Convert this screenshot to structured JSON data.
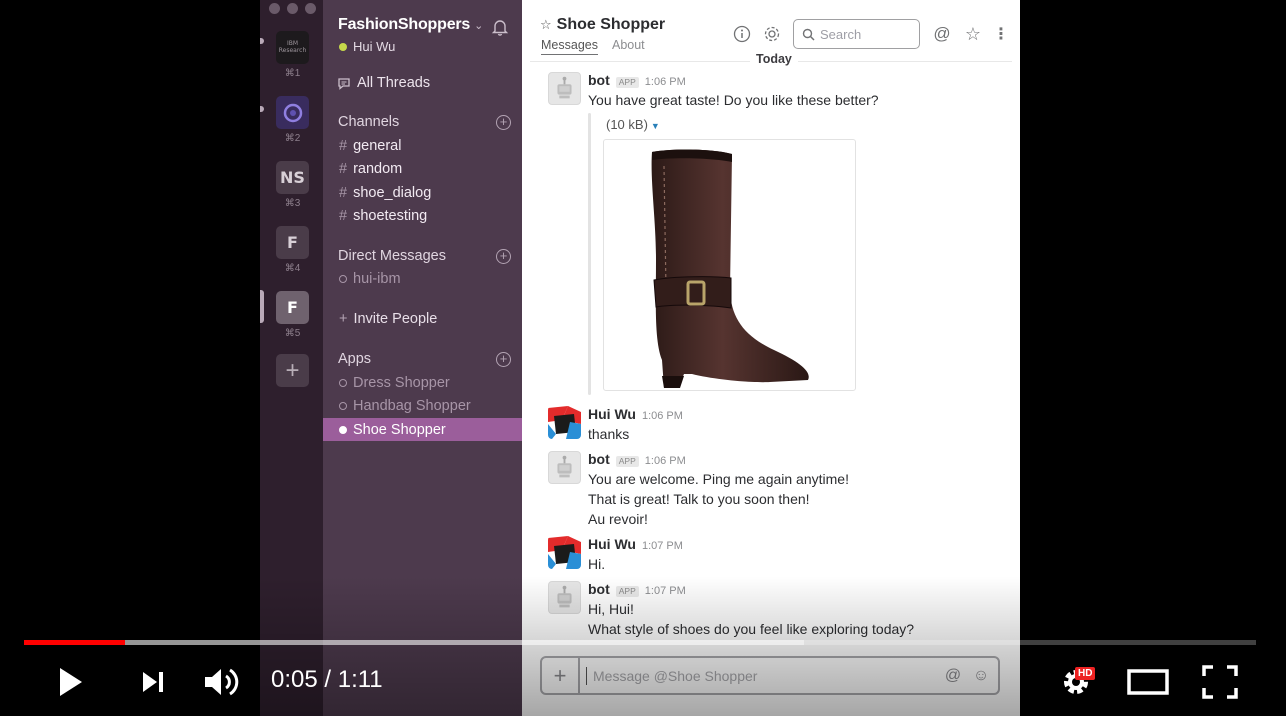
{
  "teams": [
    {
      "label": "IBM Research",
      "shortcut": "⌘1"
    },
    {
      "label": "",
      "shortcut": "⌘2"
    },
    {
      "label": "NS",
      "shortcut": "⌘3"
    },
    {
      "label": "F",
      "shortcut": "⌘4"
    },
    {
      "label": "F",
      "shortcut": "⌘5"
    }
  ],
  "sidebar": {
    "workspace": "FashionShoppers",
    "user": "Hui Wu",
    "all_threads": "All Threads",
    "channels_header": "Channels",
    "channels": [
      "general",
      "random",
      "shoe_dialog",
      "shoetesting"
    ],
    "dm_header": "Direct Messages",
    "dms": [
      "hui-ibm"
    ],
    "invite": "Invite People",
    "apps_header": "Apps",
    "apps": [
      "Dress Shopper",
      "Handbag Shopper",
      "Shoe Shopper"
    ]
  },
  "header": {
    "channel": "Shoe Shopper",
    "tab_messages": "Messages",
    "tab_about": "About",
    "search_placeholder": "Search",
    "day_divider": "Today"
  },
  "messages": [
    {
      "author": "bot",
      "badge": "APP",
      "time": "1:06 PM",
      "lines": [
        "You have great taste! Do you like these better?"
      ],
      "attachment_size": "(10 kB)"
    },
    {
      "author": "Hui Wu",
      "time": "1:06 PM",
      "lines": [
        "thanks"
      ]
    },
    {
      "author": "bot",
      "badge": "APP",
      "time": "1:06 PM",
      "lines": [
        "You are welcome. Ping me again anytime!",
        "That is great! Talk to you soon then!",
        "Au revoir!"
      ]
    },
    {
      "author": "Hui Wu",
      "time": "1:07 PM",
      "lines": [
        "Hi."
      ]
    },
    {
      "author": "bot",
      "badge": "APP",
      "time": "1:07 PM",
      "lines": [
        "Hi, Hui!",
        "What style of shoes do you feel like exploring today?"
      ]
    }
  ],
  "composer": {
    "placeholder": "Message @Shoe Shopper"
  },
  "player": {
    "time": "0:05 / 1:11",
    "played_fraction": 0.082,
    "buffered_fraction": 0.633,
    "hd_badge": "HD",
    "accent": "#ff0000"
  }
}
